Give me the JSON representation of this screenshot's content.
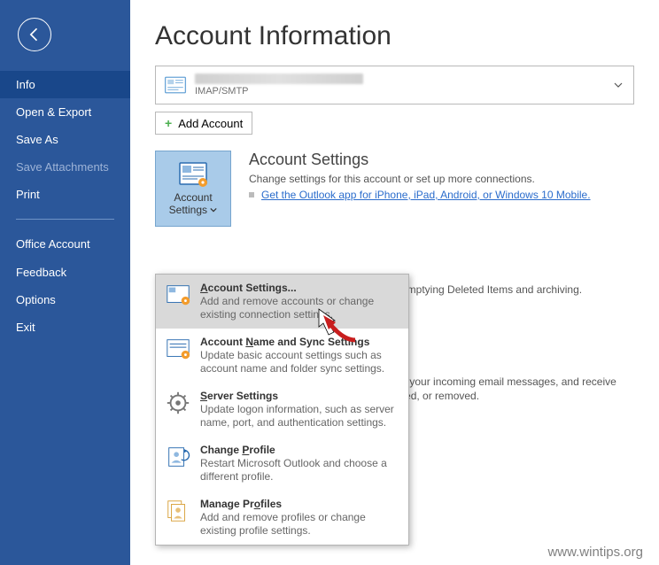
{
  "sidebar": {
    "items": [
      {
        "label": "Info",
        "state": "selected"
      },
      {
        "label": "Open & Export",
        "state": "normal"
      },
      {
        "label": "Save As",
        "state": "normal"
      },
      {
        "label": "Save Attachments",
        "state": "disabled"
      },
      {
        "label": "Print",
        "state": "normal"
      }
    ],
    "lower": [
      {
        "label": "Office Account"
      },
      {
        "label": "Feedback"
      },
      {
        "label": "Options"
      },
      {
        "label": "Exit"
      }
    ]
  },
  "page_title": "Account Information",
  "account": {
    "protocol": "IMAP/SMTP"
  },
  "add_account_label": "Add Account",
  "account_settings": {
    "button_line1": "Account",
    "button_line2": "Settings",
    "title": "Account Settings",
    "desc": "Change settings for this account or set up more connections.",
    "link": "Get the Outlook app for iPhone, iPad, Android, or Windows 10 Mobile."
  },
  "behind1": "by emptying Deleted Items and archiving.",
  "behind2": "nize your incoming email messages, and receive",
  "behind3": "anged, or removed.",
  "dropdown": [
    {
      "title_before": "",
      "title_ul": "A",
      "title_after": "ccount Settings...",
      "desc": "Add and remove accounts or change existing connection settings."
    },
    {
      "title_before": "Account ",
      "title_ul": "N",
      "title_after": "ame and Sync Settings",
      "desc": "Update basic account settings such as account name and folder sync settings."
    },
    {
      "title_before": "",
      "title_ul": "S",
      "title_after": "erver Settings",
      "desc": "Update logon information, such as server name, port, and authentication settings."
    },
    {
      "title_before": "Change ",
      "title_ul": "P",
      "title_after": "rofile",
      "desc": "Restart Microsoft Outlook and choose a different profile."
    },
    {
      "title_before": "Manage Pr",
      "title_ul": "o",
      "title_after": "files",
      "desc": "Add and remove profiles or change existing profile settings."
    }
  ],
  "watermark": "www.wintips.org"
}
